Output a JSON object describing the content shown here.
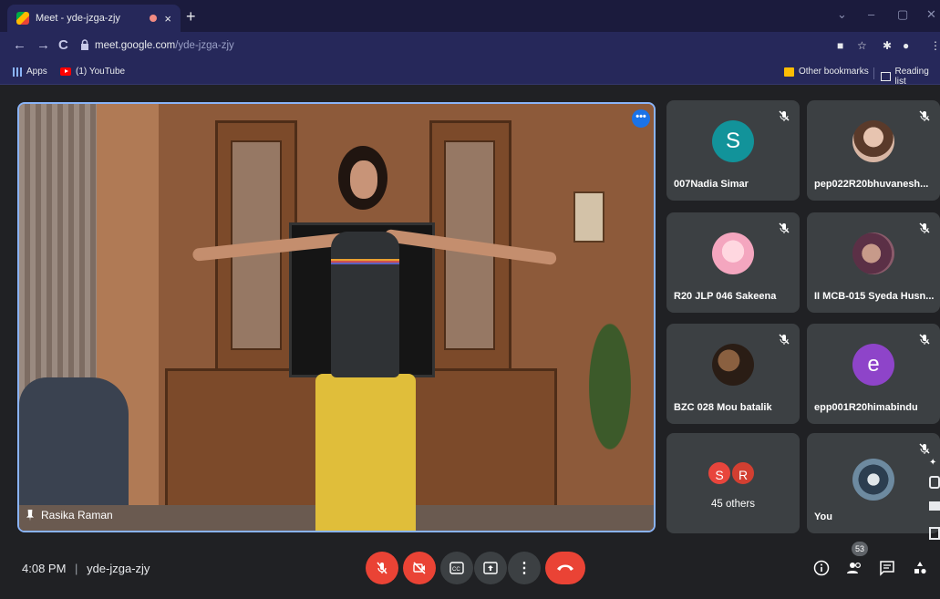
{
  "browser": {
    "tab_title": "Meet - yde-jzga-zjy",
    "tab_close": "×",
    "new_tab": "+",
    "url_host": "meet.google.com",
    "url_path": "/yde-jzga-zjy",
    "bookmarks": {
      "apps": "Apps",
      "youtube": "(1) YouTube",
      "other": "Other bookmarks",
      "reading": "Reading list"
    }
  },
  "main_video": {
    "participant": "Rasika Raman",
    "more_label": "•••"
  },
  "tiles": [
    {
      "name": "007Nadia Simar",
      "avatar_letter": "S",
      "avatar_color": "#12939a"
    },
    {
      "name": "pep022R20bhuvanesh...",
      "avatar": "photo"
    },
    {
      "name": "R20 JLP 046 Sakeena",
      "avatar": "photo"
    },
    {
      "name": "II MCB-015 Syeda Husn...",
      "avatar": "photo"
    },
    {
      "name": "BZC 028 Mou batalik",
      "avatar": "photo"
    },
    {
      "name": "epp001R20himabindu",
      "avatar_letter": "e",
      "avatar_color": "#8e44c9"
    },
    {
      "others_label": "45 others",
      "avatars": [
        "S",
        "R"
      ],
      "avatar_colors": [
        "#e8453c",
        "#d23f31"
      ]
    },
    {
      "name": "You",
      "avatar": "photo"
    }
  ],
  "bottom_bar": {
    "time": "4:08 PM",
    "separator": "|",
    "meeting_code": "yde-jzga-zjy",
    "participants_count": "53"
  },
  "colors": {
    "accent": "#8ab4f8",
    "danger": "#ea4335",
    "tile_bg": "#3c4043",
    "page_bg": "#202124"
  }
}
